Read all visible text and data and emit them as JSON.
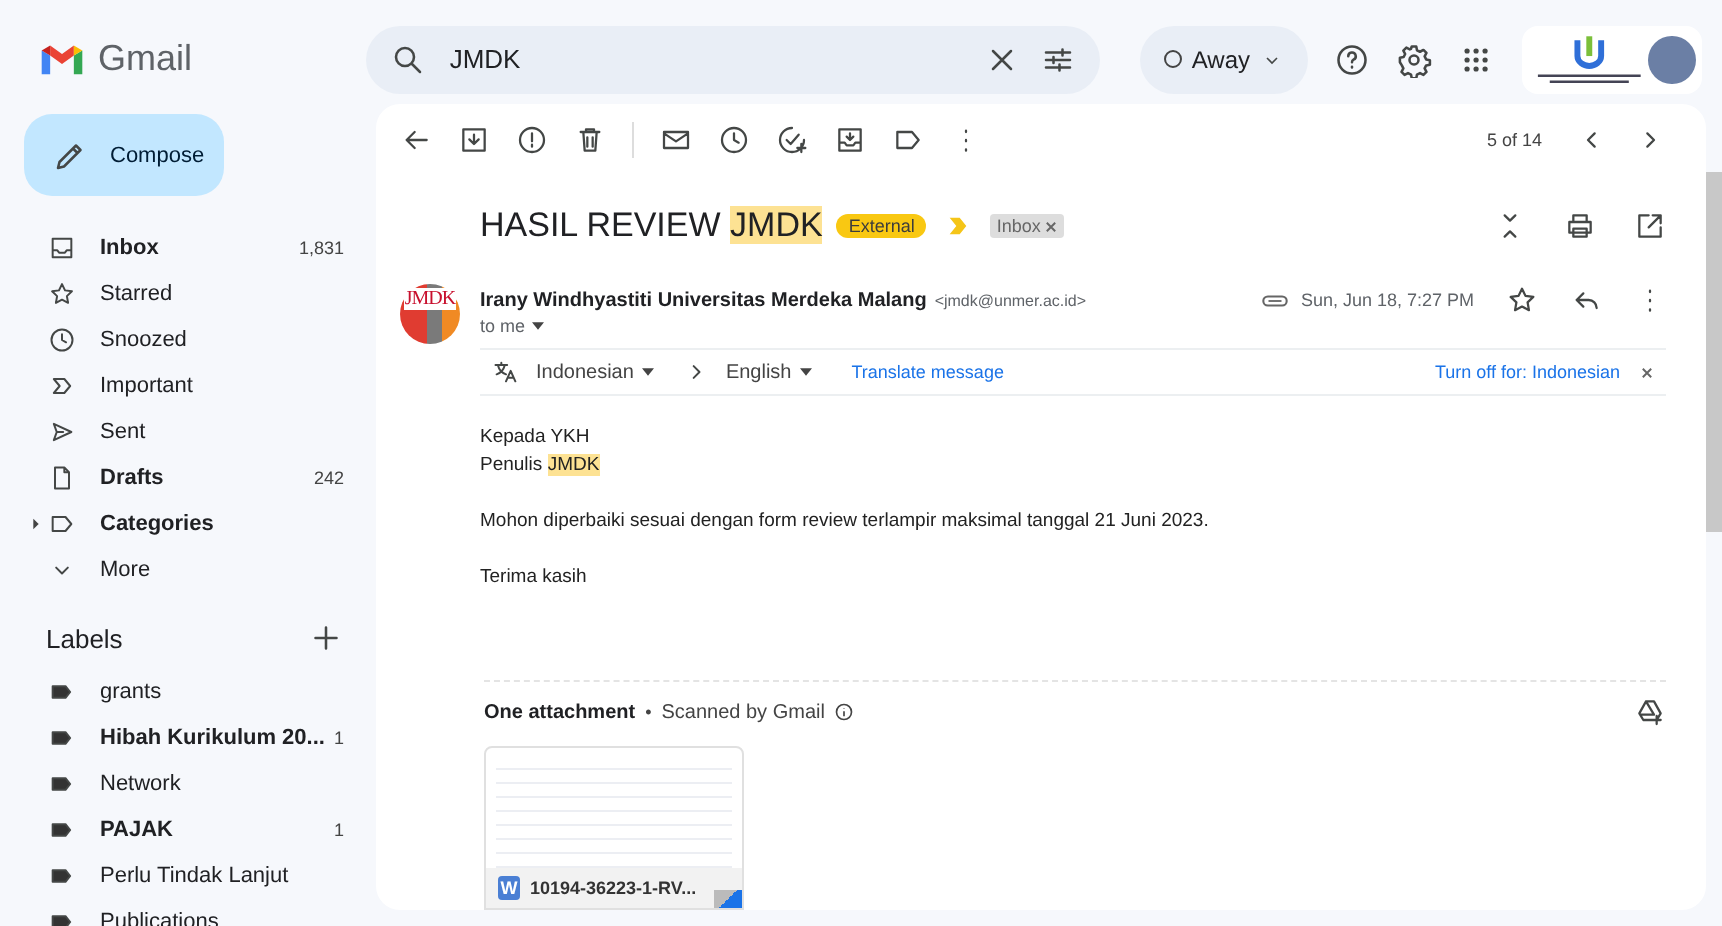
{
  "header": {
    "app_name": "Gmail",
    "search": {
      "value": "JMDK"
    },
    "status": {
      "label": "Away",
      "on": false
    }
  },
  "sidebar": {
    "compose": "Compose",
    "items": [
      {
        "label": "Inbox",
        "count": "1,831",
        "unread": true,
        "selected": false
      },
      {
        "label": "Starred",
        "unread": false,
        "selected": false
      },
      {
        "label": "Snoozed",
        "unread": false,
        "selected": false
      },
      {
        "label": "Important",
        "unread": false,
        "selected": false
      },
      {
        "label": "Sent",
        "unread": false,
        "selected": false
      },
      {
        "label": "Drafts",
        "count": "242",
        "unread": true,
        "selected": false
      },
      {
        "label": "Categories",
        "unread": true,
        "selected": false,
        "expanded": false
      },
      {
        "label": "More",
        "unread": false,
        "selected": false
      }
    ],
    "labels_title": "Labels",
    "labels": [
      {
        "name": "grants",
        "unread": false
      },
      {
        "name": "Hibah Kurikulum 20...",
        "count": "1",
        "unread": true
      },
      {
        "name": "Network",
        "unread": false
      },
      {
        "name": "PAJAK",
        "count": "1",
        "unread": true
      },
      {
        "name": "Perlu Tindak Lanjut",
        "unread": false
      },
      {
        "name": "Publications",
        "unread": false
      }
    ]
  },
  "toolbar": {
    "pagination": "5 of 14"
  },
  "message": {
    "subject": [
      {
        "text": "HASIL REVIEW",
        "highlighted": false
      },
      {
        "text": "JMDK",
        "highlighted": true
      }
    ],
    "tags": [
      {
        "kind": "external",
        "label": "External"
      },
      {
        "kind": "label",
        "label": "Inbox"
      }
    ],
    "sender": {
      "avatar_text": "JMDK",
      "name": "Irany Windhyastiti Universitas Merdeka Malang",
      "email": "<jmdk@unmer.ac.id>",
      "recipient": "to me",
      "date": "Sun, Jun 18, 7:27 PM",
      "starred": false
    },
    "translate": {
      "from": "Indonesian",
      "to": "English",
      "action": "Translate message",
      "turn_off": "Turn off for: Indonesian"
    },
    "body": [
      {
        "lines": [
          [
            {
              "text": "Kepada YKH",
              "highlighted": false
            }
          ],
          [
            {
              "text": "Penulis",
              "highlighted": false
            },
            {
              "text": "JMDK",
              "highlighted": true
            }
          ]
        ]
      },
      {
        "lines": [
          [
            {
              "text": "Mohon diperbaiki sesuai dengan form review terlampir maksimal tanggal 21 Juni 2023.",
              "highlighted": false
            }
          ]
        ]
      },
      {
        "lines": [
          [
            {
              "text": "Terima kasih",
              "highlighted": false
            }
          ]
        ]
      }
    ],
    "attachments": {
      "title": "One attachment",
      "separator": "•",
      "scan_note": "Scanned by Gmail",
      "files": [
        {
          "type_letter": "W",
          "name": "10194-36223-1-RV..."
        }
      ]
    }
  }
}
